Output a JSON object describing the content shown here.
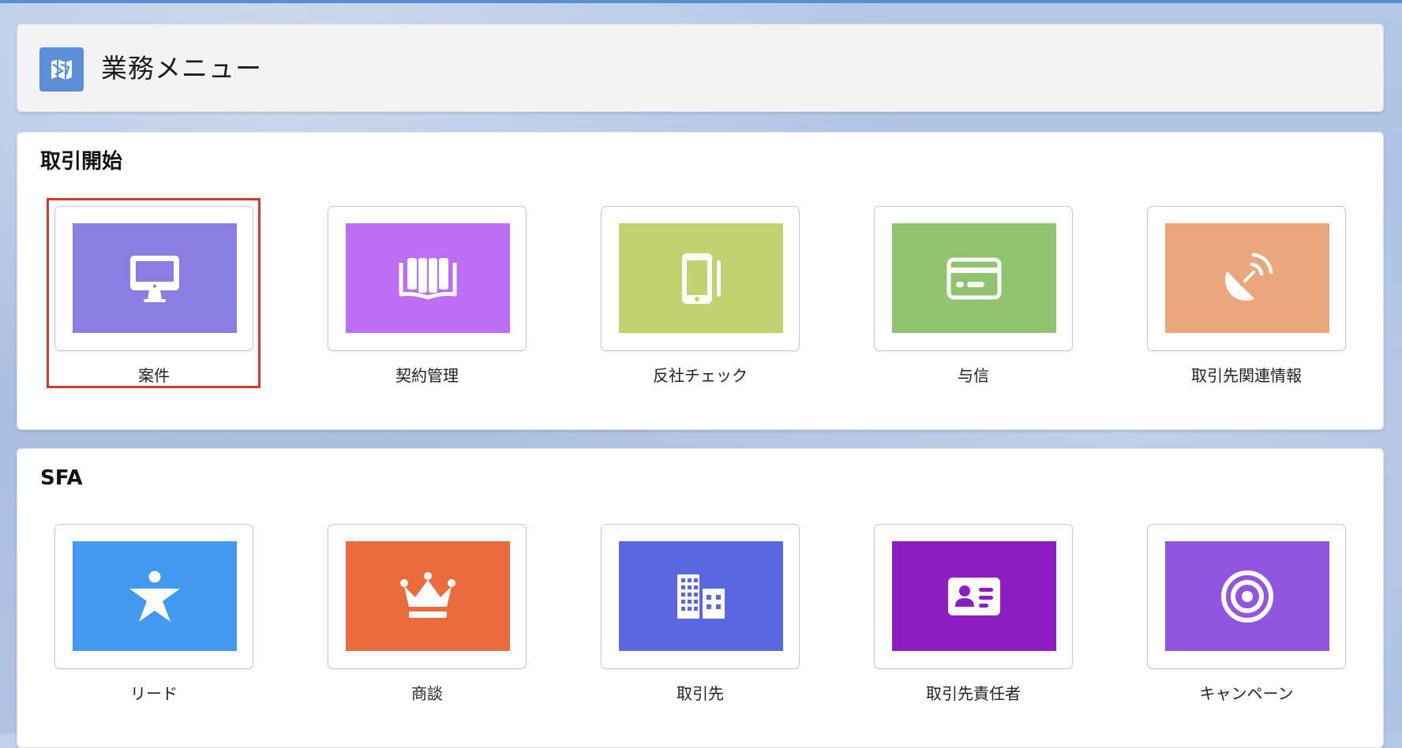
{
  "header": {
    "title": "業務メニュー",
    "icon": "map-icon",
    "icon_color": "#5d8ed8"
  },
  "sections": [
    {
      "title": "取引開始",
      "tiles": [
        {
          "label": "案件",
          "icon": "desktop-icon",
          "color": "#8a7ee3",
          "selected": true
        },
        {
          "label": "契約管理",
          "icon": "book-icon",
          "color": "#bc6ef5"
        },
        {
          "label": "反社チェック",
          "icon": "tablet-icon",
          "color": "#c4d170"
        },
        {
          "label": "与信",
          "icon": "credit-card-icon",
          "color": "#90c46f"
        },
        {
          "label": "取引先関連情報",
          "icon": "satellite-dish-icon",
          "color": "#e9a77b"
        }
      ]
    },
    {
      "title": "SFA",
      "tiles": [
        {
          "label": "リード",
          "icon": "person-star-icon",
          "color": "#4398f0"
        },
        {
          "label": "商談",
          "icon": "crown-icon",
          "color": "#eb6a3e"
        },
        {
          "label": "取引先",
          "icon": "building-icon",
          "color": "#5a67e0"
        },
        {
          "label": "取引先責任者",
          "icon": "contact-card-icon",
          "color": "#8c1ebf"
        },
        {
          "label": "キャンペーン",
          "icon": "target-icon",
          "color": "#9255e0"
        }
      ]
    }
  ],
  "highlight_color": "#d2382c"
}
